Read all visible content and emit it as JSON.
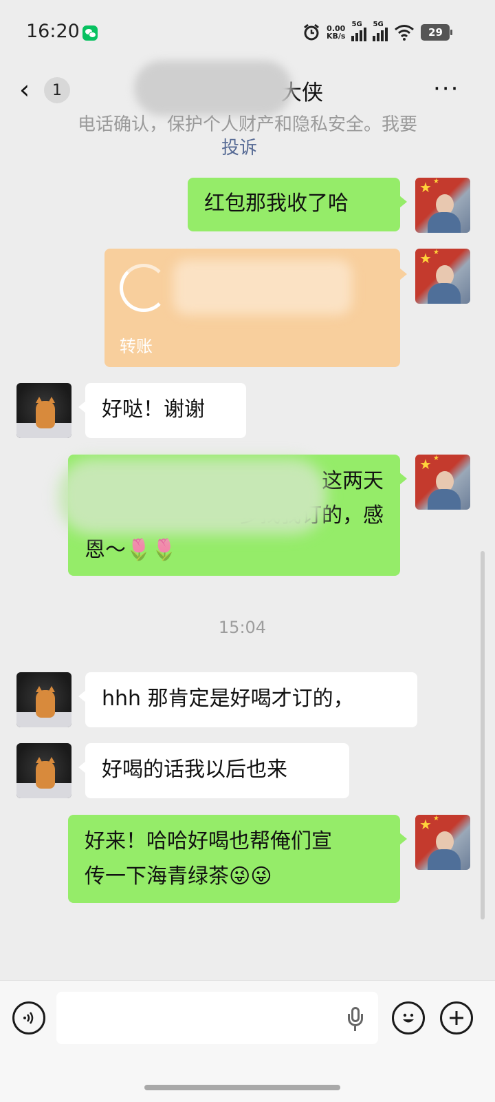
{
  "status_bar": {
    "time": "16:20",
    "net_speed_value": "0.00",
    "net_speed_unit": "KB/s",
    "signal1_label": "5G",
    "signal2_label": "5G",
    "battery": "29"
  },
  "nav": {
    "unread_count": "1",
    "title_visible": "大侠",
    "more_label": "···"
  },
  "notice": {
    "text": "电话确认，保护个人财产和隐私安全。我要",
    "link": "投诉"
  },
  "messages": [
    {
      "side": "right",
      "type": "text",
      "text": "红包那我收了哈"
    },
    {
      "side": "right",
      "type": "transfer",
      "label": "转账"
    },
    {
      "side": "left",
      "type": "text",
      "text": "好哒！谢谢"
    },
    {
      "side": "right",
      "type": "text",
      "line1": "这两天",
      "line2": "多找我订的，感",
      "line3": "恩～🌷🌷"
    },
    {
      "side": "center",
      "type": "timestamp",
      "text": "15:04"
    },
    {
      "side": "left",
      "type": "text",
      "text": "hhh 那肯定是好喝才订的，"
    },
    {
      "side": "left",
      "type": "text",
      "text": "好喝的话我以后也来"
    },
    {
      "side": "right",
      "type": "text",
      "line1": "好来！哈哈好喝也帮俺们宣",
      "line2": "传一下海青绿茶😜😜"
    }
  ],
  "input_bar": {
    "voice_icon": "voice-icon",
    "emoji_icon": "emoji-icon",
    "plus_icon": "plus-icon",
    "mic_icon": "mic-icon",
    "placeholder": ""
  }
}
